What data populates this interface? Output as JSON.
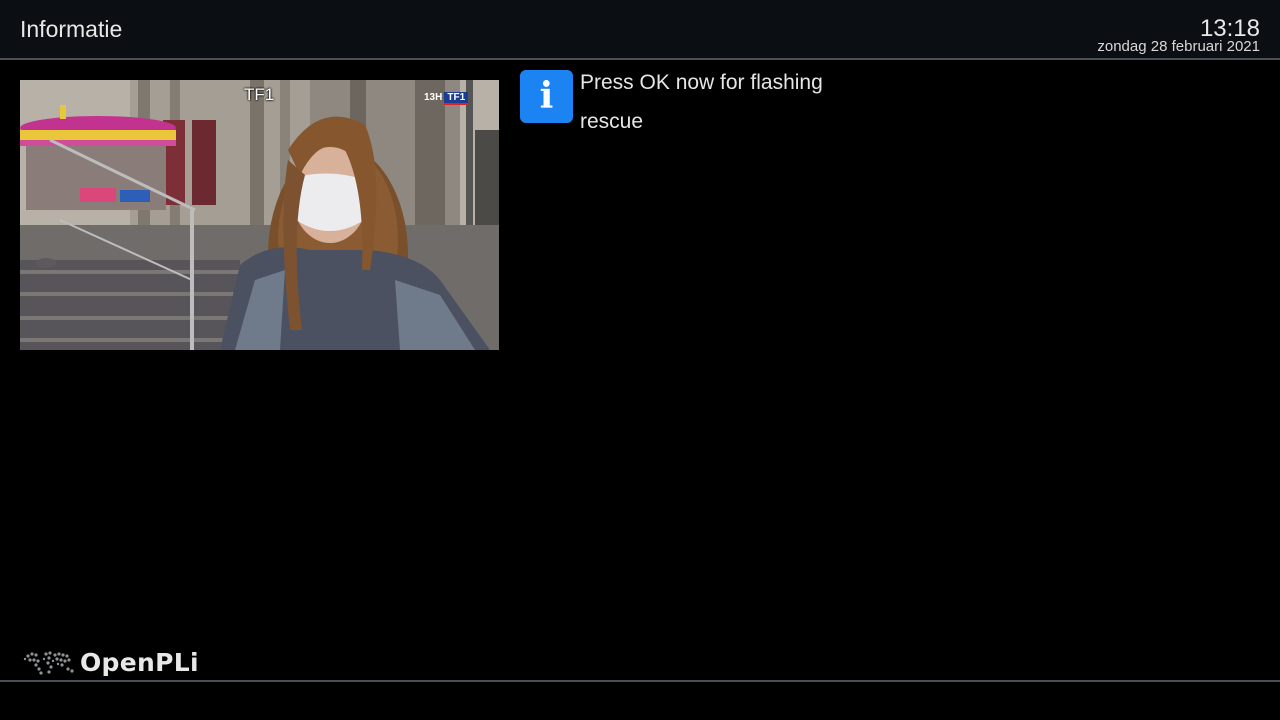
{
  "header": {
    "title": "Informatie",
    "time": "13:18",
    "date": "zondag 28 februari 2021"
  },
  "tv_preview": {
    "channel_label": "TF1",
    "corner_logo_prefix": "13H",
    "corner_logo_brand": "TF1"
  },
  "message": {
    "icon": "info-icon",
    "lines": [
      "Press OK now for flashing",
      "rescue"
    ]
  },
  "footer": {
    "brand": "OpenPLi",
    "icon": "globe-icon"
  },
  "colors": {
    "accent": "#1c83f2",
    "header_bg": "#0b0e12",
    "rule": "#4a4f55"
  }
}
